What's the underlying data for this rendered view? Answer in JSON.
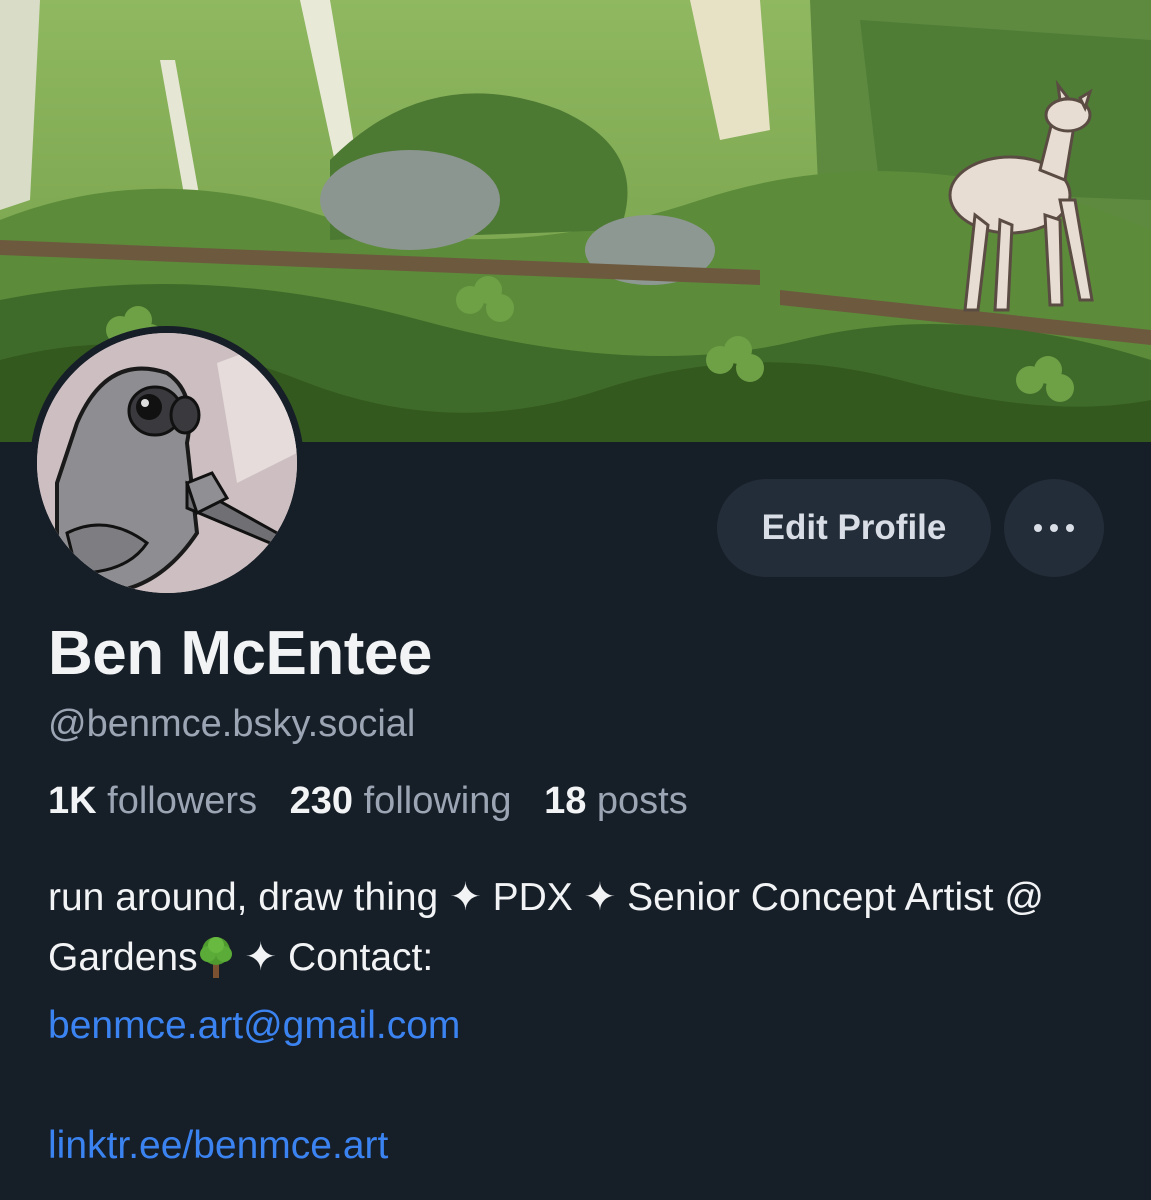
{
  "profile": {
    "display_name": "Ben McEntee",
    "handle": "@benmce.bsky.social"
  },
  "actions": {
    "edit_label": "Edit Profile",
    "more_icon": "ellipsis-icon"
  },
  "stats": {
    "followers_count": "1K",
    "followers_label": "followers",
    "following_count": "230",
    "following_label": "following",
    "posts_count": "18",
    "posts_label": "posts"
  },
  "bio": {
    "part1": "run around, draw thing ✦ PDX ✦ Senior Concept Artist @ Gardens",
    "tree_icon": "deciduous-tree-emoji",
    "part2": " ✦ Contact:",
    "email": "benmce.art@gmail.com",
    "link": "linktr.ee/benmce.art"
  },
  "colors": {
    "background": "#161e27",
    "button_bg": "#232d39",
    "link": "#3a83f1",
    "muted_text": "#9ba5b4"
  }
}
